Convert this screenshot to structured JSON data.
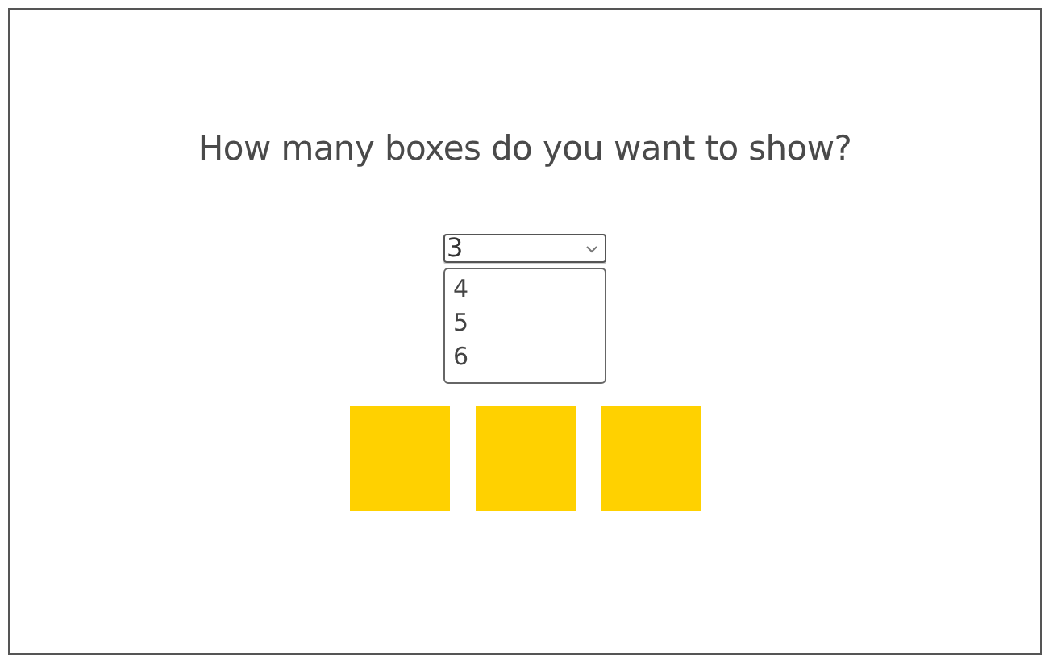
{
  "question": "How many boxes do you want to show?",
  "dropdown": {
    "value": "3",
    "expanded": true,
    "options": [
      {
        "label": "4",
        "selected": false
      },
      {
        "label": "5",
        "selected": false
      },
      {
        "label": "6",
        "selected": false
      }
    ]
  },
  "boxes": [
    {
      "kind": "square"
    },
    {
      "kind": "square"
    },
    {
      "kind": "square"
    }
  ]
}
